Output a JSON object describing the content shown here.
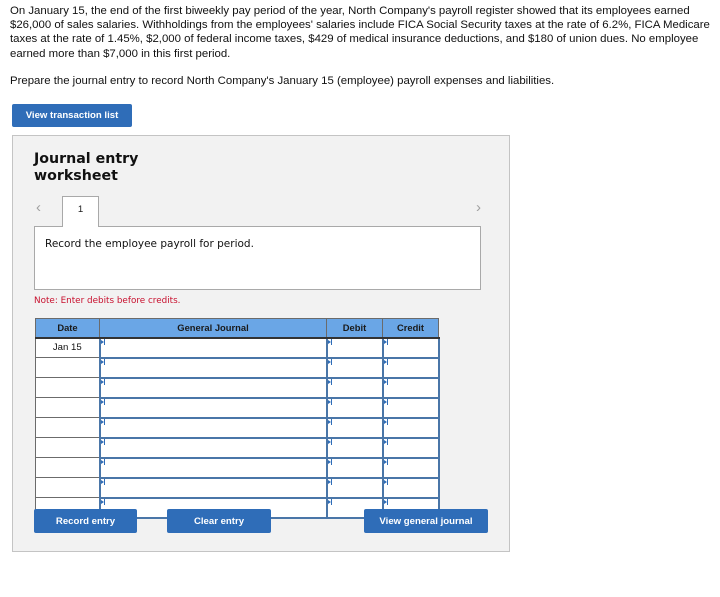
{
  "question": {
    "paragraphs": [
      "On January 15, the end of the first biweekly pay period of the year, North Company's payroll register showed that its employees earned $26,000 of sales salaries. Withholdings from the employees' salaries include FICA Social Security taxes at the rate of 6.2%, FICA Medicare taxes at the rate of 1.45%, $2,000 of federal income taxes, $429 of medical insurance deductions, and $180 of union dues. No employee earned more than $7,000 in this first period.",
      "Prepare the journal entry to record North Company's January 15 (employee) payroll expenses and liabilities."
    ]
  },
  "buttons": {
    "view_transaction_list": "View transaction list",
    "record_entry": "Record entry",
    "clear_entry": "Clear entry",
    "view_general_journal": "View general journal"
  },
  "worksheet": {
    "title": "Journal entry worksheet",
    "nav": {
      "prev_icon": "chevron-left-icon",
      "next_icon": "chevron-right-icon",
      "prev_glyph": "‹",
      "next_glyph": "›"
    },
    "tabs": [
      {
        "label": "1",
        "active": true
      }
    ],
    "instruction": "Record the employee payroll for period.",
    "note": "Note: Enter debits before credits."
  },
  "journal": {
    "columns": [
      "Date",
      "General Journal",
      "Debit",
      "Credit"
    ],
    "rows": [
      {
        "date": "Jan 15",
        "account": "",
        "debit": "",
        "credit": ""
      },
      {
        "date": "",
        "account": "",
        "debit": "",
        "credit": ""
      },
      {
        "date": "",
        "account": "",
        "debit": "",
        "credit": ""
      },
      {
        "date": "",
        "account": "",
        "debit": "",
        "credit": ""
      },
      {
        "date": "",
        "account": "",
        "debit": "",
        "credit": ""
      },
      {
        "date": "",
        "account": "",
        "debit": "",
        "credit": ""
      },
      {
        "date": "",
        "account": "",
        "debit": "",
        "credit": ""
      },
      {
        "date": "",
        "account": "",
        "debit": "",
        "credit": ""
      },
      {
        "date": "",
        "account": "",
        "debit": "",
        "credit": ""
      }
    ]
  },
  "colors": {
    "button_bg": "#2f6db8",
    "header_bg": "#6aa6e6",
    "note_red": "#c8102e",
    "worksheet_bg": "#f2f2f2",
    "input_border": "#4a76a8"
  }
}
